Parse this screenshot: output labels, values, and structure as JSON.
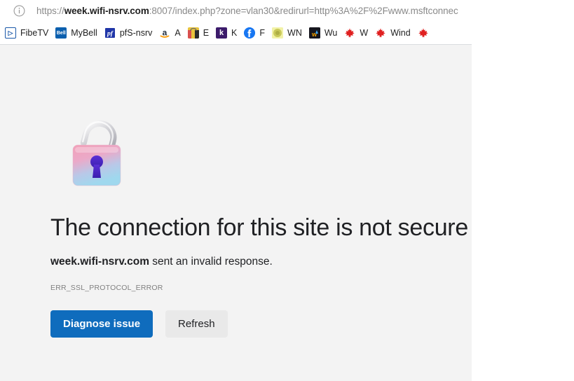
{
  "browser": {
    "address_bar": {
      "site_info_icon": "info-circle-icon",
      "url_scheme_prefix": "https://",
      "url_domain": "week.wifi-nsrv.com",
      "url_rest": ":8007/index.php?zone=vlan30&redirurl=http%3A%2F%2Fwww.msftconnec"
    },
    "bookmarks": [
      {
        "label": "FibeTV",
        "icon": "fibetv-favicon",
        "glyph": "▷"
      },
      {
        "label": "MyBell",
        "icon": "bell-favicon",
        "glyph": "Bell"
      },
      {
        "label": "pfS-nsrv",
        "icon": "pfsense-favicon",
        "glyph": "pf"
      },
      {
        "label": "A",
        "icon": "amazon-favicon",
        "glyph": "a"
      },
      {
        "label": "E",
        "icon": "etsy-favicon",
        "glyph": ""
      },
      {
        "label": "K",
        "icon": "kijiji-favicon",
        "glyph": "k"
      },
      {
        "label": "F",
        "icon": "facebook-favicon",
        "glyph": "f"
      },
      {
        "label": "WN",
        "icon": "wn-favicon",
        "glyph": ""
      },
      {
        "label": "Wu",
        "icon": "wu-favicon",
        "glyph": "wu"
      },
      {
        "label": "W",
        "icon": "maple-leaf-favicon",
        "glyph": "🍁"
      },
      {
        "label": "Wind",
        "icon": "maple-leaf-favicon",
        "glyph": "🍁"
      },
      {
        "label": "",
        "icon": "maple-leaf-favicon",
        "glyph": "🍁"
      }
    ]
  },
  "error_page": {
    "illustration": "open-padlock-icon",
    "heading": "The connection for this site is not secure",
    "subtitle_host": "week.wifi-nsrv.com",
    "subtitle_rest": " sent an invalid response.",
    "error_code": "ERR_SSL_PROTOCOL_ERROR",
    "buttons": {
      "primary_label": "Diagnose issue",
      "secondary_label": "Refresh"
    }
  },
  "colors": {
    "primary_button": "#0f6cbd",
    "page_background": "#f3f3f3",
    "heading_text": "#202124",
    "error_code_text": "#808080",
    "url_text": "#8a8a8a"
  }
}
